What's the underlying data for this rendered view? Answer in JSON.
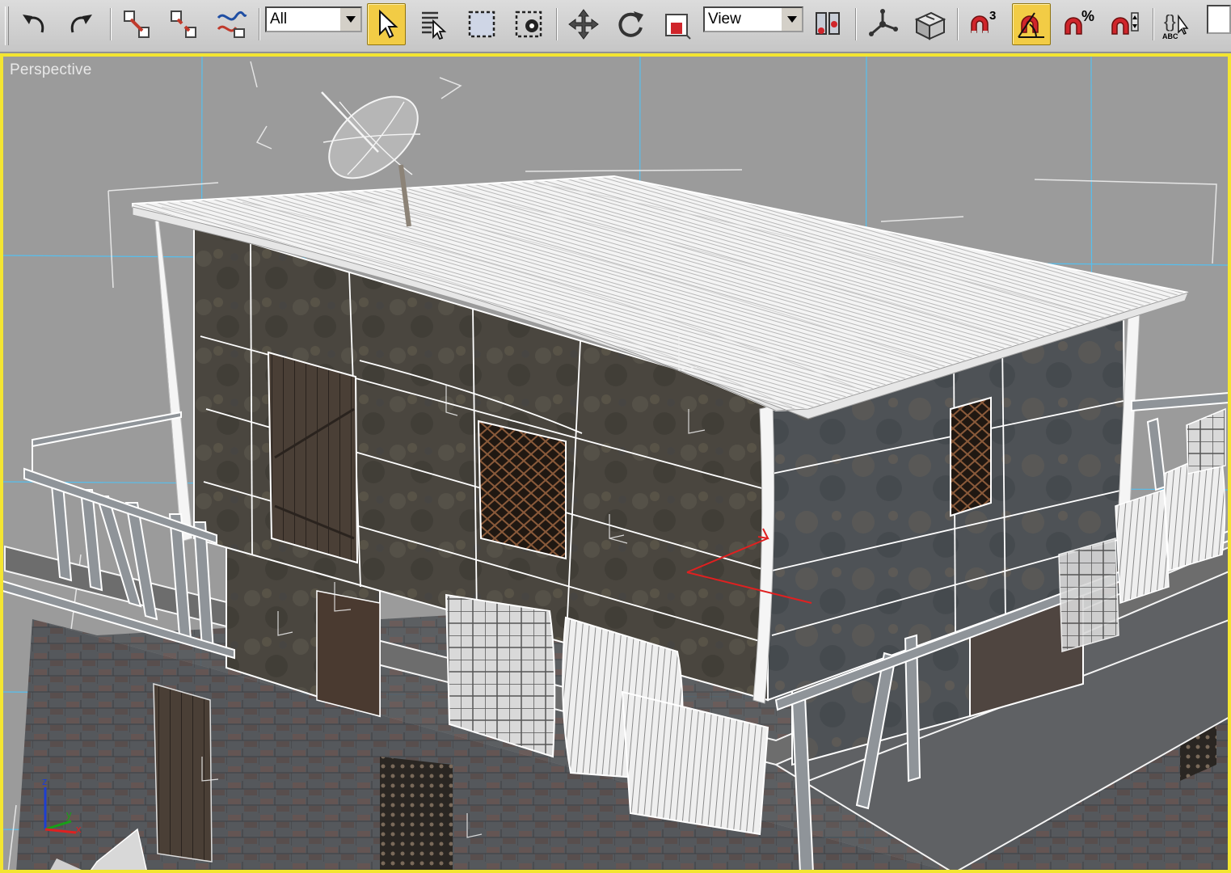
{
  "toolbar": {
    "selection_filter": {
      "value": "All"
    },
    "coordinate_system": {
      "value": "View"
    },
    "snap_toggle": {
      "label": "3"
    },
    "percent_snap": {
      "label": "%"
    },
    "named_selection": {
      "label": "ABC"
    },
    "buttons": [
      {
        "name": "undo-button",
        "icon": "undo-icon"
      },
      {
        "name": "redo-button",
        "icon": "redo-icon"
      },
      {
        "name": "select-and-link-button",
        "icon": "link-icon"
      },
      {
        "name": "unlink-selection-button",
        "icon": "unlink-icon"
      },
      {
        "name": "bind-to-space-warp-button",
        "icon": "space-warp-icon"
      },
      {
        "name": "select-object-button",
        "icon": "cursor-arrow-icon",
        "active": true
      },
      {
        "name": "select-by-name-button",
        "icon": "select-by-name-icon"
      },
      {
        "name": "rectangular-selection-button",
        "icon": "rect-select-icon"
      },
      {
        "name": "window-crossing-button",
        "icon": "window-crossing-icon"
      },
      {
        "name": "select-and-move-button",
        "icon": "move-icon"
      },
      {
        "name": "select-and-rotate-button",
        "icon": "rotate-icon"
      },
      {
        "name": "select-and-scale-button",
        "icon": "scale-icon"
      },
      {
        "name": "use-pivot-point-button",
        "icon": "pivot-center-icon"
      },
      {
        "name": "select-and-manipulate-button",
        "icon": "manipulate-icon"
      },
      {
        "name": "keyboard-shortcut-override-button",
        "icon": "keyboard-shortcut-icon"
      },
      {
        "name": "snaps-toggle-button",
        "icon": "magnet-3d-icon"
      },
      {
        "name": "angle-snap-toggle-button",
        "icon": "angle-snap-icon",
        "active": true
      },
      {
        "name": "percent-snap-toggle-button",
        "icon": "percent-snap-icon"
      },
      {
        "name": "spinner-snap-toggle-button",
        "icon": "spinner-snap-icon"
      },
      {
        "name": "edit-named-selection-button",
        "icon": "named-selection-icon"
      }
    ]
  },
  "viewport": {
    "label": "Perspective",
    "border_color": "#f3e531",
    "background_color": "#9a9a9a",
    "grid_color": "#4fc3f7",
    "axis_tripod": {
      "x": "x",
      "y": "y",
      "z": "z"
    }
  }
}
